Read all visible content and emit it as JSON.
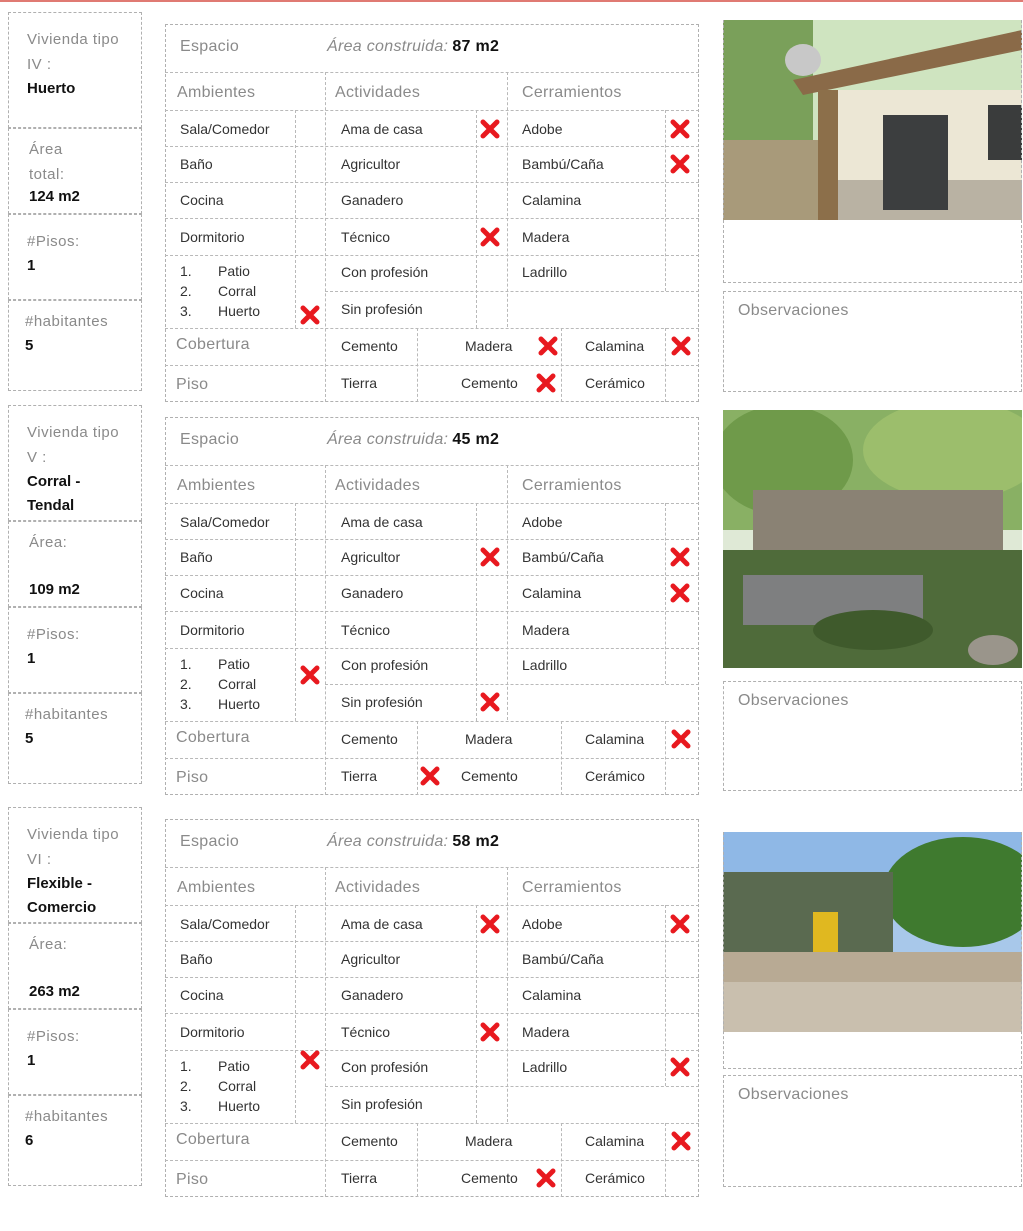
{
  "houses": [
    {
      "title_label": "Vivienda tipo IV :",
      "title_value": "Huerto",
      "area_label": "Área total:",
      "area_value": "124 m2",
      "floors_label": "#Pisos:",
      "floors_value": "1",
      "inhabitants_label": "#habitantes",
      "inhabitants_value": "5",
      "space_label": "Espacio",
      "built_area_label": "Área construida:",
      "built_area_value": "87 m2",
      "col_headers": [
        "Ambientes",
        "Actividades",
        "Cerramientos"
      ],
      "ambientes": [
        "Sala/Comedor",
        "Baño",
        "Cocina",
        "Dormitorio"
      ],
      "sub_items": [
        "1.",
        "Patio",
        "2.",
        "Corral",
        "3.",
        "Huerto"
      ],
      "actividades": [
        "Ama de casa",
        "Agricultor",
        "Ganadero",
        "Técnico",
        "Con profesión",
        "Sin profesión"
      ],
      "cerramientos": [
        "Adobe",
        "Bambú/Caña",
        "Calamina",
        "Madera",
        "Ladrillo"
      ],
      "cobertura_label": "Cobertura",
      "cobertura_options": [
        "Cemento",
        "Madera",
        "Calamina"
      ],
      "piso_label": "Piso",
      "piso_options": [
        "Tierra",
        "Cemento",
        "Cerámico"
      ],
      "ambientes_marks": [
        false,
        false,
        false,
        false
      ],
      "sub_mark": true,
      "actividades_marks": [
        true,
        false,
        false,
        true,
        false,
        false
      ],
      "cerramientos_marks": [
        true,
        true,
        false,
        false,
        false
      ],
      "cobertura_marks": [
        false,
        true,
        true
      ],
      "piso_marks": [
        false,
        true,
        false
      ],
      "observations_label": "Observaciones"
    },
    {
      "title_label": "Vivienda tipo V :",
      "title_value": "Corral - Tendal",
      "area_label": "Área:",
      "area_value": "109 m2",
      "floors_label": "#Pisos:",
      "floors_value": "1",
      "inhabitants_label": "#habitantes",
      "inhabitants_value": "5",
      "space_label": "Espacio",
      "built_area_label": "Área construida:",
      "built_area_value": "45 m2",
      "col_headers": [
        "Ambientes",
        "Actividades",
        "Cerramientos"
      ],
      "ambientes": [
        "Sala/Comedor",
        "Baño",
        "Cocina",
        "Dormitorio"
      ],
      "sub_items": [
        "1.",
        "Patio",
        "2.",
        "Corral",
        "3.",
        "Huerto"
      ],
      "actividades": [
        "Ama de casa",
        "Agricultor",
        "Ganadero",
        "Técnico",
        "Con profesión",
        "Sin profesión"
      ],
      "cerramientos": [
        "Adobe",
        "Bambú/Caña",
        "Calamina",
        "Madera",
        "Ladrillo"
      ],
      "cobertura_label": "Cobertura",
      "cobertura_options": [
        "Cemento",
        "Madera",
        "Calamina"
      ],
      "piso_label": "Piso",
      "piso_options": [
        "Tierra",
        "Cemento",
        "Cerámico"
      ],
      "ambientes_marks": [
        false,
        false,
        false,
        false
      ],
      "sub_mark": true,
      "actividades_marks": [
        false,
        true,
        false,
        false,
        false,
        true
      ],
      "cerramientos_marks": [
        false,
        true,
        true,
        false,
        false
      ],
      "cobertura_marks": [
        false,
        false,
        true
      ],
      "piso_marks": [
        true,
        false,
        false
      ],
      "observations_label": "Observaciones"
    },
    {
      "title_label": "Vivienda tipo VI :",
      "title_value": "Flexible - Comercio",
      "area_label": "Área:",
      "area_value": "263 m2",
      "floors_label": "#Pisos:",
      "floors_value": "1",
      "inhabitants_label": "#habitantes",
      "inhabitants_value": "6",
      "space_label": "Espacio",
      "built_area_label": "Área construida:",
      "built_area_value": "58 m2",
      "col_headers": [
        "Ambientes",
        "Actividades",
        "Cerramientos"
      ],
      "ambientes": [
        "Sala/Comedor",
        "Baño",
        "Cocina",
        "Dormitorio"
      ],
      "sub_items": [
        "1.",
        "Patio",
        "2.",
        "Corral",
        "3.",
        "Huerto"
      ],
      "actividades": [
        "Ama de casa",
        "Agricultor",
        "Ganadero",
        "Técnico",
        "Con profesión",
        "Sin profesión"
      ],
      "cerramientos": [
        "Adobe",
        "Bambú/Caña",
        "Calamina",
        "Madera",
        "Ladrillo"
      ],
      "cobertura_label": "Cobertura",
      "cobertura_options": [
        "Cemento",
        "Madera",
        "Calamina"
      ],
      "piso_label": "Piso",
      "piso_options": [
        "Tierra",
        "Cemento",
        "Cerámico"
      ],
      "ambientes_marks": [
        false,
        false,
        false,
        false
      ],
      "sub_mark": true,
      "actividades_marks": [
        true,
        false,
        false,
        true,
        false,
        false
      ],
      "cerramientos_marks": [
        true,
        false,
        false,
        false,
        true
      ],
      "cobertura_marks": [
        false,
        false,
        true
      ],
      "piso_marks": [
        false,
        true,
        false
      ],
      "observations_label": "Observaciones"
    }
  ],
  "colors": {
    "mark": "#e8191f",
    "border": "#b0b0b0",
    "label": "#8a8a8a"
  }
}
